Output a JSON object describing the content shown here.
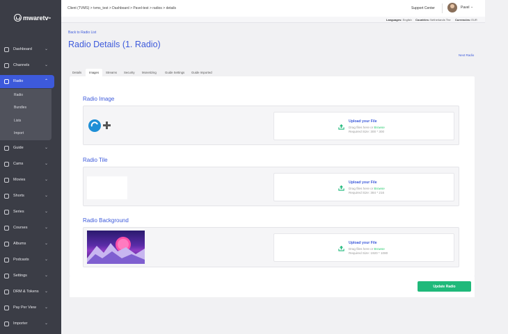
{
  "brand": {
    "name": "mwaretv",
    "mark": "tv"
  },
  "sidebar": {
    "items": [
      {
        "label": "Dashboard",
        "icon": "dashboard-icon"
      },
      {
        "label": "Channels",
        "icon": "channels-icon"
      },
      {
        "label": "Radio",
        "icon": "radio-icon",
        "active": true
      },
      {
        "label": "Guide",
        "icon": "guide-icon"
      },
      {
        "label": "Cams",
        "icon": "cams-icon"
      },
      {
        "label": "Movies",
        "icon": "movies-icon"
      },
      {
        "label": "Shorts",
        "icon": "shorts-icon"
      },
      {
        "label": "Series",
        "icon": "series-icon"
      },
      {
        "label": "Courses",
        "icon": "courses-icon"
      },
      {
        "label": "Albums",
        "icon": "albums-icon"
      },
      {
        "label": "Podcasts",
        "icon": "podcasts-icon"
      },
      {
        "label": "Settings",
        "icon": "settings-icon"
      },
      {
        "label": "DRM & Tokens",
        "icon": "drm-icon"
      },
      {
        "label": "Pay Per View",
        "icon": "ppv-icon"
      },
      {
        "label": "Importer",
        "icon": "importer-icon"
      }
    ],
    "radio_sub": [
      "Radio",
      "Bundles",
      "Lists",
      "Import"
    ]
  },
  "topbar": {
    "breadcrumb": "Client (TVMS) > tvms_test > Dashboard > Pavel-test > radios > details",
    "support": "Support Center",
    "user": "Pavel",
    "languages_label": "Languages:",
    "languages_value": "English",
    "countries_label": "Countries:",
    "countries_value": "Netherlands The",
    "currencies_label": "Currencies:",
    "currencies_value": "EUR"
  },
  "page": {
    "back": "Back to Radio List",
    "title": "Radio Details (1. Radio)",
    "next": "Next Radio",
    "tabs": [
      "Details",
      "Images",
      "Streams",
      "Security",
      "Monetizing",
      "Guide Settings",
      "Guide Imported"
    ],
    "active_tab": "Images"
  },
  "sections": [
    {
      "title": "Radio Image",
      "upload_title": "Upload your File",
      "drag": "Drag files here or",
      "browse": "Browse",
      "size": "Required Size: 300 * 300"
    },
    {
      "title": "Radio Tile",
      "upload_title": "Upload your File",
      "drag": "Drag files here or",
      "browse": "Browse",
      "size": "Required Size: 384 * 216"
    },
    {
      "title": "Radio Background",
      "upload_title": "Upload your File",
      "drag": "Drag files here or",
      "browse": "Browse",
      "size": "Required Size: 1920 * 1080"
    }
  ],
  "actions": {
    "update": "Update Radio"
  },
  "colors": {
    "accent": "#3d5adb",
    "success": "#1fb97a",
    "sidebar": "#3b3d46"
  }
}
